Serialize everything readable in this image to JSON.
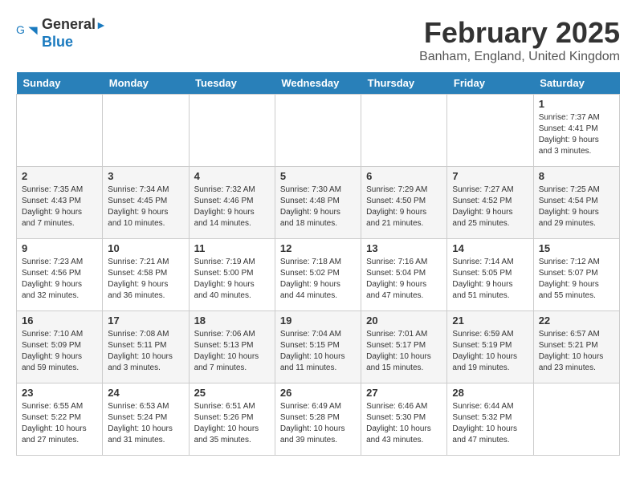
{
  "header": {
    "logo_line1": "General",
    "logo_line2": "Blue",
    "month_title": "February 2025",
    "location": "Banham, England, United Kingdom"
  },
  "days_of_week": [
    "Sunday",
    "Monday",
    "Tuesday",
    "Wednesday",
    "Thursday",
    "Friday",
    "Saturday"
  ],
  "weeks": [
    {
      "days": [
        {
          "num": "",
          "info": ""
        },
        {
          "num": "",
          "info": ""
        },
        {
          "num": "",
          "info": ""
        },
        {
          "num": "",
          "info": ""
        },
        {
          "num": "",
          "info": ""
        },
        {
          "num": "",
          "info": ""
        },
        {
          "num": "1",
          "info": "Sunrise: 7:37 AM\nSunset: 4:41 PM\nDaylight: 9 hours and 3 minutes."
        }
      ]
    },
    {
      "days": [
        {
          "num": "2",
          "info": "Sunrise: 7:35 AM\nSunset: 4:43 PM\nDaylight: 9 hours and 7 minutes."
        },
        {
          "num": "3",
          "info": "Sunrise: 7:34 AM\nSunset: 4:45 PM\nDaylight: 9 hours and 10 minutes."
        },
        {
          "num": "4",
          "info": "Sunrise: 7:32 AM\nSunset: 4:46 PM\nDaylight: 9 hours and 14 minutes."
        },
        {
          "num": "5",
          "info": "Sunrise: 7:30 AM\nSunset: 4:48 PM\nDaylight: 9 hours and 18 minutes."
        },
        {
          "num": "6",
          "info": "Sunrise: 7:29 AM\nSunset: 4:50 PM\nDaylight: 9 hours and 21 minutes."
        },
        {
          "num": "7",
          "info": "Sunrise: 7:27 AM\nSunset: 4:52 PM\nDaylight: 9 hours and 25 minutes."
        },
        {
          "num": "8",
          "info": "Sunrise: 7:25 AM\nSunset: 4:54 PM\nDaylight: 9 hours and 29 minutes."
        }
      ]
    },
    {
      "days": [
        {
          "num": "9",
          "info": "Sunrise: 7:23 AM\nSunset: 4:56 PM\nDaylight: 9 hours and 32 minutes."
        },
        {
          "num": "10",
          "info": "Sunrise: 7:21 AM\nSunset: 4:58 PM\nDaylight: 9 hours and 36 minutes."
        },
        {
          "num": "11",
          "info": "Sunrise: 7:19 AM\nSunset: 5:00 PM\nDaylight: 9 hours and 40 minutes."
        },
        {
          "num": "12",
          "info": "Sunrise: 7:18 AM\nSunset: 5:02 PM\nDaylight: 9 hours and 44 minutes."
        },
        {
          "num": "13",
          "info": "Sunrise: 7:16 AM\nSunset: 5:04 PM\nDaylight: 9 hours and 47 minutes."
        },
        {
          "num": "14",
          "info": "Sunrise: 7:14 AM\nSunset: 5:05 PM\nDaylight: 9 hours and 51 minutes."
        },
        {
          "num": "15",
          "info": "Sunrise: 7:12 AM\nSunset: 5:07 PM\nDaylight: 9 hours and 55 minutes."
        }
      ]
    },
    {
      "days": [
        {
          "num": "16",
          "info": "Sunrise: 7:10 AM\nSunset: 5:09 PM\nDaylight: 9 hours and 59 minutes."
        },
        {
          "num": "17",
          "info": "Sunrise: 7:08 AM\nSunset: 5:11 PM\nDaylight: 10 hours and 3 minutes."
        },
        {
          "num": "18",
          "info": "Sunrise: 7:06 AM\nSunset: 5:13 PM\nDaylight: 10 hours and 7 minutes."
        },
        {
          "num": "19",
          "info": "Sunrise: 7:04 AM\nSunset: 5:15 PM\nDaylight: 10 hours and 11 minutes."
        },
        {
          "num": "20",
          "info": "Sunrise: 7:01 AM\nSunset: 5:17 PM\nDaylight: 10 hours and 15 minutes."
        },
        {
          "num": "21",
          "info": "Sunrise: 6:59 AM\nSunset: 5:19 PM\nDaylight: 10 hours and 19 minutes."
        },
        {
          "num": "22",
          "info": "Sunrise: 6:57 AM\nSunset: 5:21 PM\nDaylight: 10 hours and 23 minutes."
        }
      ]
    },
    {
      "days": [
        {
          "num": "23",
          "info": "Sunrise: 6:55 AM\nSunset: 5:22 PM\nDaylight: 10 hours and 27 minutes."
        },
        {
          "num": "24",
          "info": "Sunrise: 6:53 AM\nSunset: 5:24 PM\nDaylight: 10 hours and 31 minutes."
        },
        {
          "num": "25",
          "info": "Sunrise: 6:51 AM\nSunset: 5:26 PM\nDaylight: 10 hours and 35 minutes."
        },
        {
          "num": "26",
          "info": "Sunrise: 6:49 AM\nSunset: 5:28 PM\nDaylight: 10 hours and 39 minutes."
        },
        {
          "num": "27",
          "info": "Sunrise: 6:46 AM\nSunset: 5:30 PM\nDaylight: 10 hours and 43 minutes."
        },
        {
          "num": "28",
          "info": "Sunrise: 6:44 AM\nSunset: 5:32 PM\nDaylight: 10 hours and 47 minutes."
        },
        {
          "num": "",
          "info": ""
        }
      ]
    }
  ]
}
